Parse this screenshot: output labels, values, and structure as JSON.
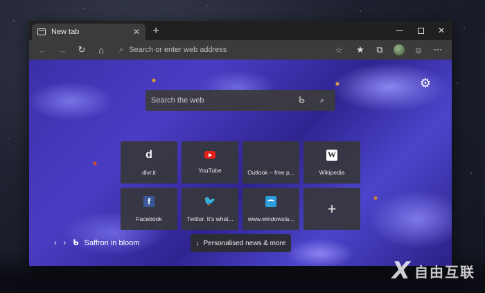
{
  "tab": {
    "title": "New tab",
    "close": "✕"
  },
  "new_tab_symbol": "+",
  "window_controls": {
    "close": "✕"
  },
  "toolbar": {
    "back": "←",
    "forward": "→",
    "refresh": "↻",
    "home": "⌂",
    "address_search_glyph": "⌕",
    "address_placeholder": "Search or enter web address",
    "favorite": "☆",
    "favorites": "★",
    "collections": "⧉",
    "emoji": "☺",
    "more": "⋯"
  },
  "newtab": {
    "settings_glyph": "⚙",
    "search_placeholder": "Search the web",
    "bing_glyph": "ᑲ",
    "search_glyph": "⌕",
    "tiles": [
      {
        "label": "dlvr.it",
        "icon": "dlvr-icon",
        "glyph": "d"
      },
      {
        "label": "YouTube",
        "icon": "youtube-icon",
        "glyph": ""
      },
      {
        "label": "Outlook – free p...",
        "icon": "microsoft-icon",
        "glyph": ""
      },
      {
        "label": "Wikipedia",
        "icon": "wikipedia-icon",
        "glyph": "W"
      },
      {
        "label": "Facebook",
        "icon": "facebook-icon",
        "glyph": "f"
      },
      {
        "label": "Twitter. It's what...",
        "icon": "twitter-icon",
        "glyph": "🐦"
      },
      {
        "label": "www.windowsla...",
        "icon": "windows-central-icon",
        "glyph": ""
      },
      {
        "label": "",
        "icon": "add-icon",
        "glyph": "+"
      }
    ],
    "photo_prev": "‹",
    "photo_next": "›",
    "photo_bing_glyph": "ᑲ",
    "photo_caption": "Saffron in bloom",
    "news_arrow": "↓",
    "news_label": "Personalised news & more"
  },
  "watermark": {
    "mark": "X",
    "text": "自由互联"
  },
  "colors": {
    "accent": "#4a3dc4",
    "chrome": "#202020",
    "toolbar": "#3b3b3b"
  }
}
